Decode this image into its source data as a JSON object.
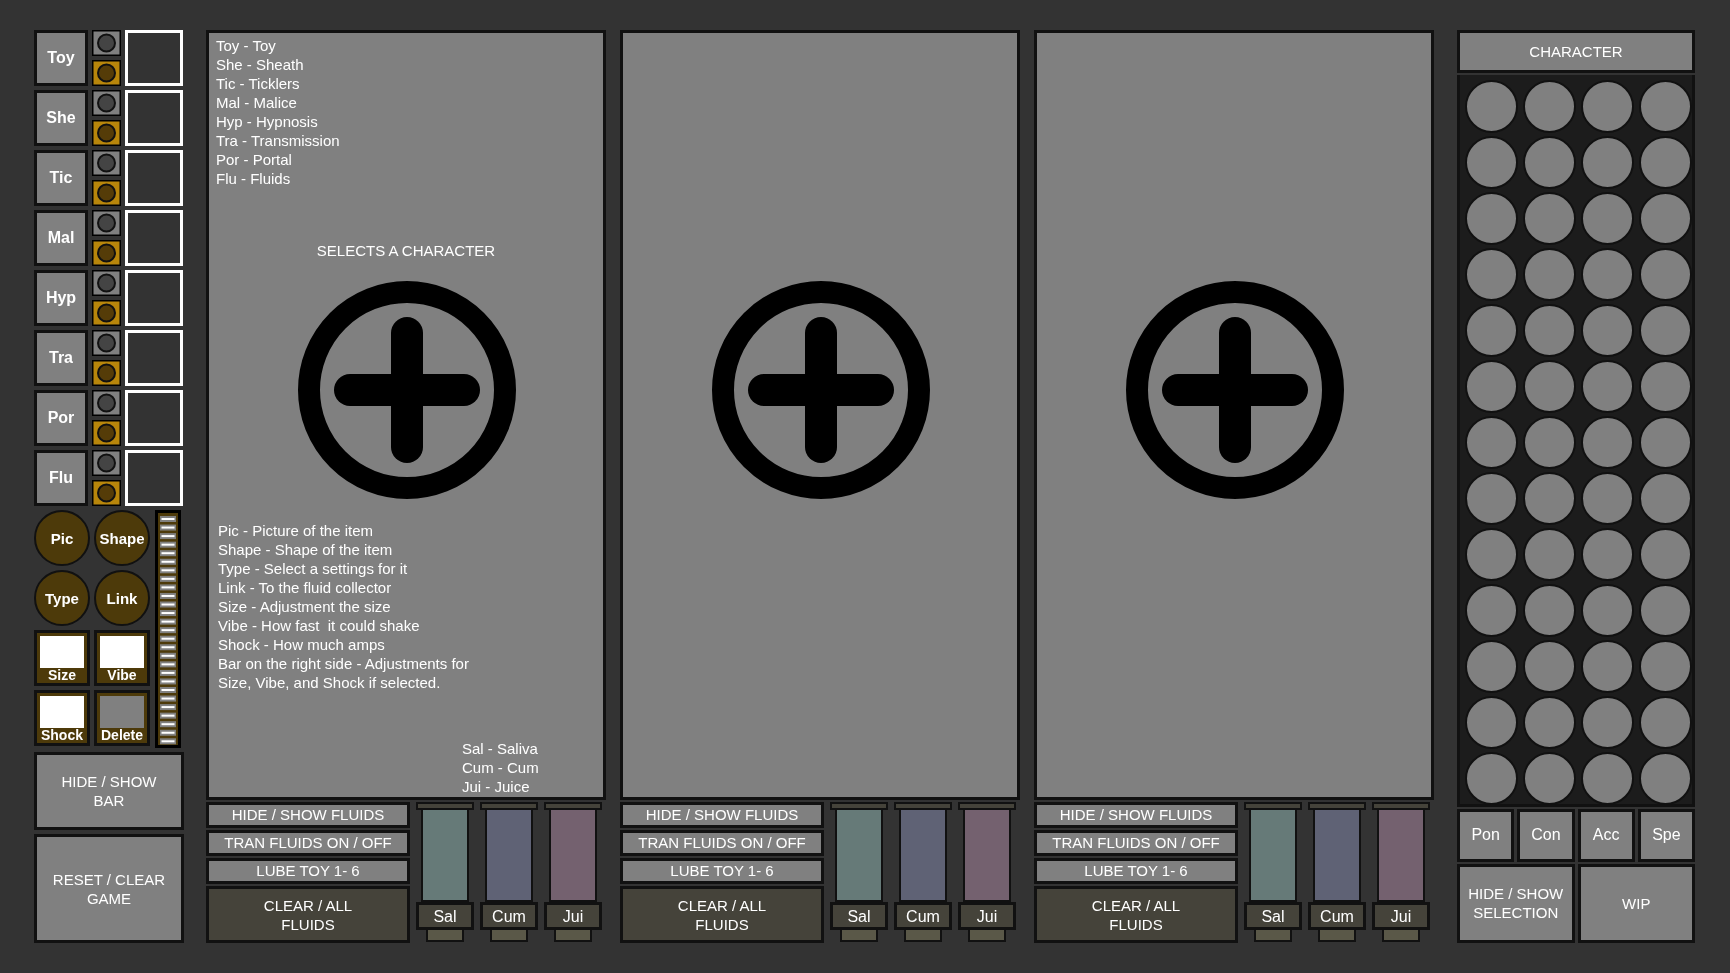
{
  "categories": [
    {
      "label": "Toy"
    },
    {
      "label": "She"
    },
    {
      "label": "Tic"
    },
    {
      "label": "Mal"
    },
    {
      "label": "Hyp"
    },
    {
      "label": "Tra"
    },
    {
      "label": "Por"
    },
    {
      "label": "Flu"
    }
  ],
  "item_tools": [
    {
      "label": "Pic",
      "kind": "round"
    },
    {
      "label": "Shape",
      "kind": "round"
    },
    {
      "label": "Type",
      "kind": "round"
    },
    {
      "label": "Link",
      "kind": "round"
    },
    {
      "label": "Size",
      "kind": "square",
      "on": true
    },
    {
      "label": "Vibe",
      "kind": "square",
      "on": true
    },
    {
      "label": "Shock",
      "kind": "square",
      "on": true
    },
    {
      "label": "Delete",
      "kind": "square",
      "on": false
    }
  ],
  "side_buttons": [
    {
      "lines": [
        "HIDE / SHOW",
        "BAR"
      ]
    },
    {
      "lines": [
        "RESET / CLEAR",
        "GAME"
      ]
    }
  ],
  "panels": [
    {
      "legend": [
        "Toy - Toy",
        "She - Sheath",
        "Tic - Ticklers",
        "Mal - Malice",
        "Hyp - Hypnosis",
        "Tra - Transmission",
        "Por - Portal",
        "Flu - Fluids"
      ],
      "heading": "SELECTS A CHARACTER",
      "details": [
        "Pic - Picture of the item",
        "Shape - Shape of the item",
        "Type - Select a settings for it",
        "Link - To the fluid collector",
        "Size - Adjustment the size",
        "Vibe - How fast  it could shake",
        "Shock - How much amps",
        "Bar on the right side - Adjustments for",
        "Size, Vibe, and Shock if selected."
      ],
      "fluid_legend": [
        "Sal - Saliva",
        "Cum - Cum",
        "Jui - Juice"
      ],
      "buttons": [
        {
          "kind": "light",
          "lines": [
            "HIDE / SHOW FLUIDS"
          ]
        },
        {
          "kind": "light",
          "lines": [
            "TRAN FLUIDS ON / OFF"
          ]
        },
        {
          "kind": "light",
          "lines": [
            "LUBE TOY 1- 6"
          ]
        },
        {
          "kind": "dark",
          "lines": [
            "CLEAR / ALL",
            "FLUIDS"
          ]
        }
      ],
      "tubes": [
        {
          "label": "Sal",
          "color": "#667a78"
        },
        {
          "label": "Cum",
          "color": "#5f6275"
        },
        {
          "label": "Jui",
          "color": "#74616f"
        }
      ]
    },
    {
      "buttons": [
        {
          "kind": "light",
          "lines": [
            "HIDE / SHOW FLUIDS"
          ]
        },
        {
          "kind": "light",
          "lines": [
            "TRAN FLUIDS ON / OFF"
          ]
        },
        {
          "kind": "light",
          "lines": [
            "LUBE TOY 1- 6"
          ]
        },
        {
          "kind": "dark",
          "lines": [
            "CLEAR / ALL",
            "FLUIDS"
          ]
        }
      ],
      "tubes": [
        {
          "label": "Sal",
          "color": "#667a78"
        },
        {
          "label": "Cum",
          "color": "#5f6275"
        },
        {
          "label": "Jui",
          "color": "#74616f"
        }
      ]
    },
    {
      "buttons": [
        {
          "kind": "light",
          "lines": [
            "HIDE / SHOW FLUIDS"
          ]
        },
        {
          "kind": "light",
          "lines": [
            "TRAN FLUIDS ON / OFF"
          ]
        },
        {
          "kind": "light",
          "lines": [
            "LUBE TOY 1- 6"
          ]
        },
        {
          "kind": "dark",
          "lines": [
            "CLEAR / ALL",
            "FLUIDS"
          ]
        }
      ],
      "tubes": [
        {
          "label": "Sal",
          "color": "#667a78"
        },
        {
          "label": "Cum",
          "color": "#5f6275"
        },
        {
          "label": "Jui",
          "color": "#74616f"
        }
      ]
    }
  ],
  "character": {
    "title": "CHARACTER",
    "filters": [
      {
        "label": "Pon"
      },
      {
        "label": "Con"
      },
      {
        "label": "Acc"
      },
      {
        "label": "Spe"
      }
    ],
    "buttons": [
      {
        "lines": [
          "HIDE / SHOW",
          "SELECTION"
        ]
      },
      {
        "lines": [
          "WIP"
        ]
      }
    ]
  }
}
